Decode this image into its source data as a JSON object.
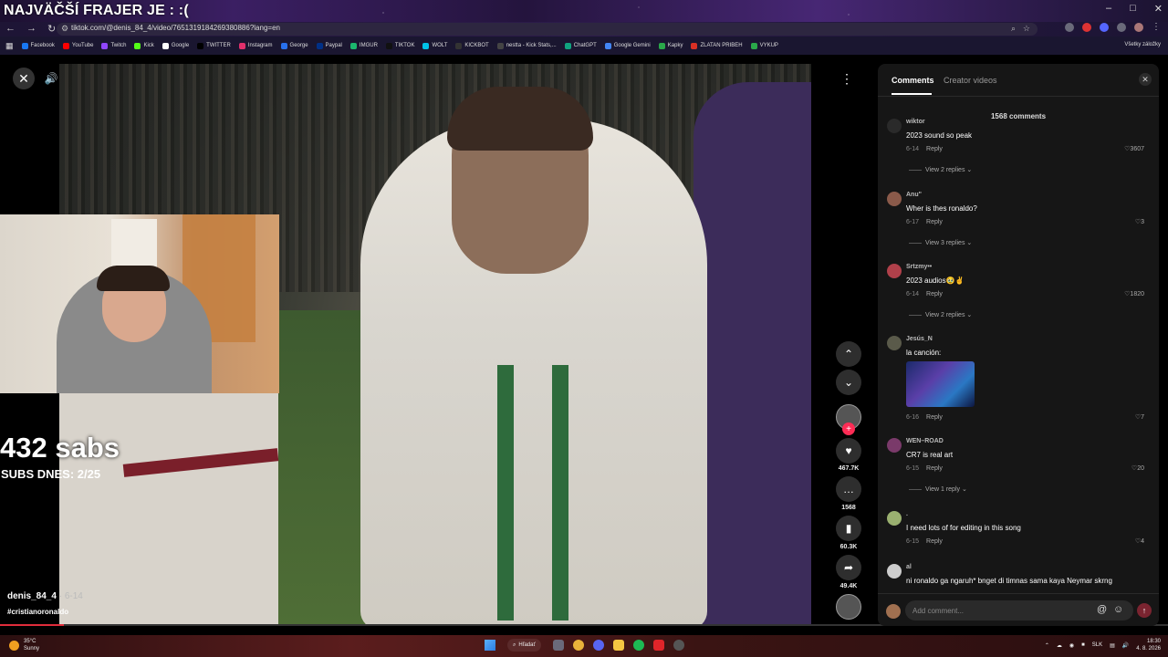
{
  "stream": {
    "title": "NAJVÄČŠÍ FRAJER JE :  :(",
    "subs_count": "432 sabs",
    "subs_today": "SUBS DNES: 2/25"
  },
  "browser": {
    "url": "tiktok.com/@denis_84_4/video/7651319184269380886?lang=en",
    "bookmarks": [
      {
        "label": "Facebook",
        "color": "#1877f2"
      },
      {
        "label": "YouTube",
        "color": "#ff0000"
      },
      {
        "label": "Twitch",
        "color": "#9146ff"
      },
      {
        "label": "Kick",
        "color": "#53fc18"
      },
      {
        "label": "Google",
        "color": "#ffffff"
      },
      {
        "label": "TWITTER",
        "color": "#000000"
      },
      {
        "label": "Instagram",
        "color": "#e1306c"
      },
      {
        "label": "George",
        "color": "#2870ed"
      },
      {
        "label": "Paypal",
        "color": "#003087"
      },
      {
        "label": "IMGUR",
        "color": "#1bb76e"
      },
      {
        "label": "TIKTOK",
        "color": "#111111"
      },
      {
        "label": "WOLT",
        "color": "#00c2e8"
      },
      {
        "label": "KICKBOT",
        "color": "#333333"
      },
      {
        "label": "nestta - Kick Stats,...",
        "color": "#444444"
      },
      {
        "label": "ChatGPT",
        "color": "#10a37f"
      },
      {
        "label": "Google Gemini",
        "color": "#4285f4"
      },
      {
        "label": "Kapky",
        "color": "#2aa84a"
      },
      {
        "label": "ZLATAN PRIBEH",
        "color": "#d93025"
      },
      {
        "label": "VYKUP",
        "color": "#2aa84a"
      }
    ],
    "bookmarks_right": "Všetky záložky"
  },
  "video": {
    "author": "denis_84_4",
    "date": "· 6-14",
    "hashtag": "#cristianoronaldo",
    "progress": 0.055
  },
  "rail": {
    "likes": "467.7K",
    "comments": "1568",
    "saves": "60.3K",
    "shares": "49.4K"
  },
  "panel": {
    "tab_comments": "Comments",
    "tab_creator": "Creator videos",
    "count": "1568 comments",
    "reply_label": "Reply",
    "comments": [
      {
        "user": "wiktor",
        "text": "2023 sound so peak",
        "date": "6-14",
        "likes": "3607",
        "replies": "View 2 replies",
        "avatar": "#2a2a2a"
      },
      {
        "user": "Anu\"",
        "text": "Wher is thes ronaldo?",
        "date": "6-17",
        "likes": "3",
        "replies": "View 3 replies",
        "avatar": "#8a5a4a"
      },
      {
        "user": "Srtzmy••",
        "text": "2023 audios🥹✌️",
        "date": "6-14",
        "likes": "1820",
        "replies": "View 2 replies",
        "avatar": "#b0404a"
      },
      {
        "user": "Jesús_N",
        "text": "la canción:",
        "date": "6-16",
        "likes": "7",
        "replies": "",
        "avatar": "#5a5a4a"
      },
      {
        "user": "WEN–ROAD",
        "text": "CR7 is real art",
        "date": "6-15",
        "likes": "20",
        "replies": "View 1 reply",
        "avatar": "#7a3a6a"
      },
      {
        "user": ".",
        "text": "I need lots of for editing in this song",
        "date": "6-15",
        "likes": "4",
        "replies": "",
        "avatar": "#9ab070"
      },
      {
        "user": "al",
        "text": "ni ronaldo ga ngaruh* bnget di timnas sama kaya Neymar skrng",
        "date": "",
        "likes": "",
        "replies": "",
        "avatar": "#cccccc"
      }
    ],
    "input_placeholder": "Add comment..."
  },
  "taskbar": {
    "temp": "35°C",
    "weather": "Sunny",
    "search": "Hľadať",
    "lang": "SLK",
    "time": "18:30",
    "date": "4. 8. 2026"
  }
}
